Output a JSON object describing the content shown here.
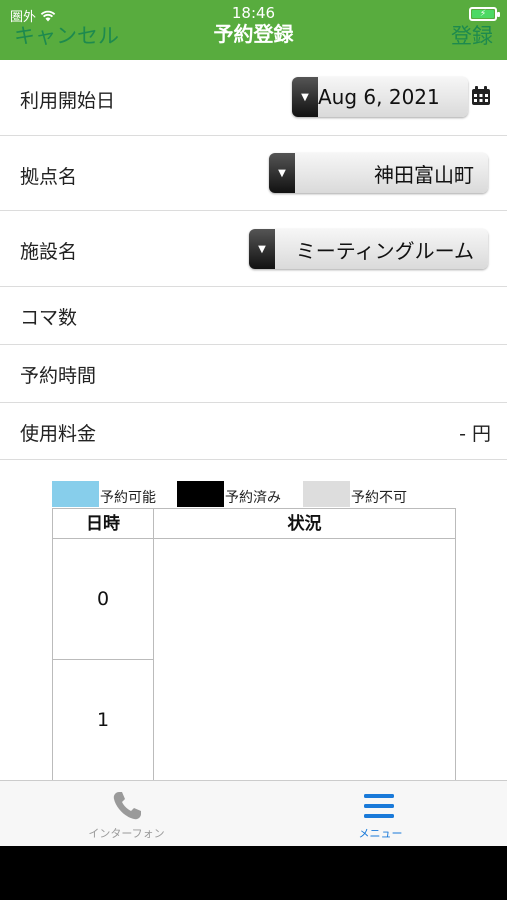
{
  "status_bar": {
    "carrier": "圏外",
    "time": "18:46"
  },
  "nav": {
    "cancel_label": "キャンセル",
    "title": "予約登録",
    "save_label": "登録"
  },
  "form": {
    "start_date_label": "利用開始日",
    "start_date_value": "Aug 6, 2021",
    "location_label": "拠点名",
    "location_value": "神田富山町",
    "facility_label": "施設名",
    "facility_value": "ミーティングルーム",
    "slots_label": "コマ数",
    "time_label": "予約時間",
    "price_label": "使用料金",
    "price_value": "- 円"
  },
  "legend": [
    {
      "label": "予約可能",
      "color": "#87ceeb"
    },
    {
      "label": "予約済み",
      "color": "#000000"
    },
    {
      "label": "予約不可",
      "color": "#dddddd"
    }
  ],
  "schedule": {
    "header_date": "日時",
    "header_status": "状況",
    "hours": [
      "0",
      "1"
    ]
  },
  "tabbar": {
    "intercom_label": "インターフォン",
    "menu_label": "メニュー"
  },
  "colors": {
    "header_bg": "#58ac3e",
    "nav_button": "#1d8a4e",
    "active_tab": "#1a7ad9",
    "inactive_tab": "#999999"
  },
  "icons": {
    "calendar": "calendar-icon",
    "phone": "phone-icon",
    "menu": "hamburger-menu-icon",
    "wifi": "wifi-icon",
    "battery": "battery-charging-icon",
    "dropdown": "dropdown-arrow-icon"
  }
}
